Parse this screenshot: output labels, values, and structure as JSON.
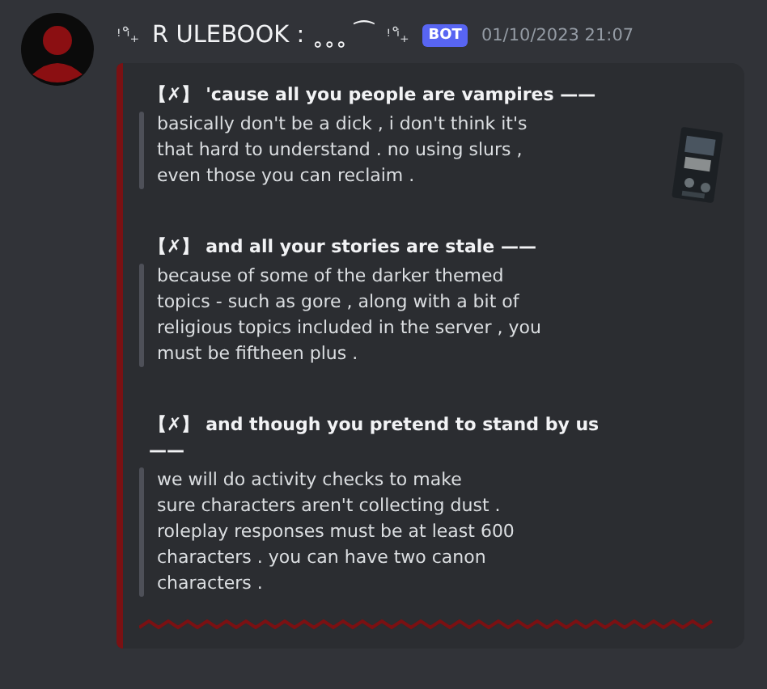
{
  "message": {
    "prefix_decoration": "ꜝ ⁱ̊₊",
    "author": "R ULEBOOK : ˳˳˳ ⁀",
    "suffix_decoration": "ꜝ ⁱ̊₊",
    "badge": "BOT",
    "timestamp": "01/10/2023 21:07"
  },
  "embed": {
    "sections": [
      {
        "marker": "【✗】",
        "title": "'cause all you people are vampires ——",
        "lines": [
          "basically don't be a dick , i don't think it's",
          "that hard to understand . no using slurs ,",
          "even those you can reclaim ."
        ]
      },
      {
        "marker": "【✗】",
        "title": "and all your stories are stale ——",
        "lines": [
          "because of some of the darker themed",
          "topics - such as gore , along with a bit of",
          "religious topics included in the server , you",
          "must be fiftheen plus ."
        ]
      },
      {
        "marker": "【✗】",
        "title": "and though you pretend to stand by us ——",
        "lines": [
          "we will do activity checks to make",
          "sure characters aren't collecting dust .",
          "roleplay responses must be at least 600",
          "characters . you can have two canon",
          "characters ."
        ]
      }
    ]
  }
}
